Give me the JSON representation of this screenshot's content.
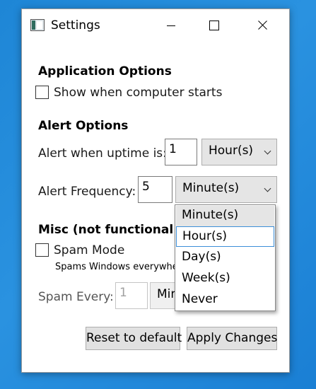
{
  "window": {
    "title": "Settings"
  },
  "application_options": {
    "heading": "Application Options",
    "show_on_startup_label": "Show when computer starts",
    "show_on_startup_checked": false
  },
  "alert_options": {
    "heading": "Alert Options",
    "uptime_label": "Alert when uptime is:",
    "uptime_value": "1",
    "uptime_unit": "Hour(s)",
    "frequency_label": "Alert Frequency:",
    "frequency_value": "5",
    "frequency_unit": "Minute(s)"
  },
  "frequency_dropdown": {
    "options": [
      "Minute(s)",
      "Hour(s)",
      "Day(s)",
      "Week(s)",
      "Never"
    ],
    "selected_index": 0,
    "focused_index": 1
  },
  "misc": {
    "heading": "Misc (not functional ye",
    "spam_mode_label": "Spam Mode",
    "spam_mode_checked": false,
    "spam_mode_description": "Spams Windows everywhe",
    "spam_every_label": "Spam Every:",
    "spam_every_value": "1",
    "spam_every_unit": "Min"
  },
  "buttons": {
    "reset_label": "Reset to default",
    "apply_label": "Apply Changes"
  }
}
